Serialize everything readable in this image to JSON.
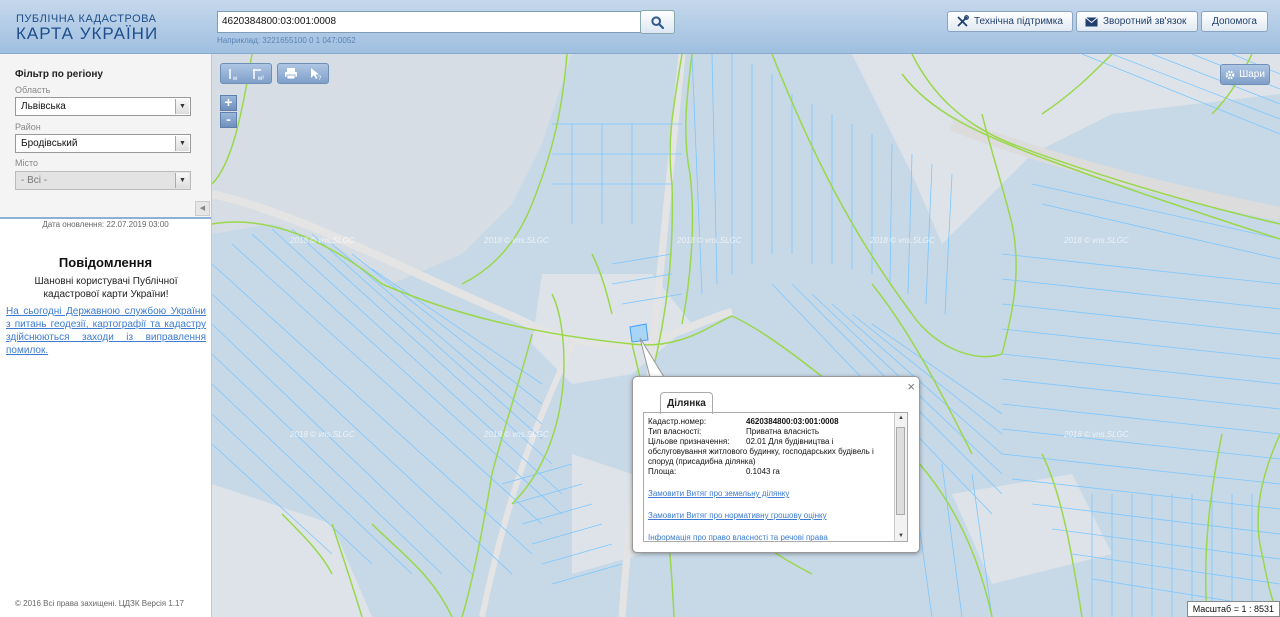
{
  "header": {
    "logo_line1": "ПУБЛІЧНА КАДАСТРОВА",
    "logo_line2": "КАРТА УКРАЇНИ",
    "search_value": "4620384800:03:001:0008",
    "search_hint": "Наприклад: 3221655100 0 1 047:0052",
    "btn_support": "Технічна підтримка",
    "btn_feedback": "Зворотний зв'язок",
    "btn_help": "Допомога"
  },
  "sidebar": {
    "filter_title": "Фільтр по регіону",
    "region_label": "Область",
    "region_value": "Львівська",
    "district_label": "Район",
    "district_value": "Бродівський",
    "city_label": "Місто",
    "city_value": "- Всі -",
    "update_date": "Дата оновлення: 22.07.2019 03:00",
    "notice_title": "Повідомлення",
    "notice_text": "Шановні користувачі Публічної кадастрової карти України!",
    "notice_link": "На сьогодні Державною службою України з питань геодезії, картографії та кадастру здійснюються заходи із виправлення помилок.",
    "copyright": "© 2016 Всі права захищені. ЦДЗК Версія 1.17"
  },
  "map": {
    "layers_label": "Шари",
    "scale": "Масштаб = 1 : 8531",
    "watermark": "2018 © vns.SLGC",
    "zoom_in": "+",
    "zoom_out": "-",
    "colors": {
      "parcel_fill": "#c7d8e7",
      "parcel_line": "#7cc7ff",
      "boundary": "#9ad84a",
      "road": "#dadada"
    }
  },
  "popup": {
    "tab_label": "Ділянка",
    "close": "×",
    "cadastral_label": "Кадастр.номер:",
    "cadastral_value": "4620384800:03:001:0008",
    "ownership_label": "Тип власності:",
    "ownership_value": "Приватна власність",
    "purpose_label": "Цільове призначення:",
    "purpose_value_1": "02.01 Для будівництва і",
    "purpose_value_2": "обслуговування житлового будинку, господарських будівель і споруд (присадибна ділянка)",
    "area_label": "Площа:",
    "area_value": "0.1043 га",
    "link1": "Замовити Витяг про земельну ділянку",
    "link2": "Замовити Витяг про нормативну грошову оцінку",
    "link3": "Інформація про право власності та речові права"
  }
}
